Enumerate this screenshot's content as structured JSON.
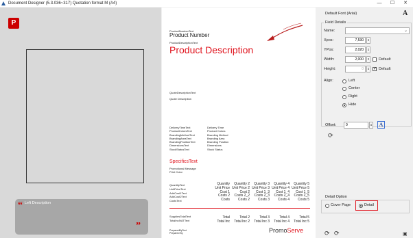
{
  "window": {
    "title": "Document Designer (5.3.036~317) Quotation format M (A4)",
    "minimize": "—",
    "maximize": "☐",
    "close": "✕"
  },
  "left_panel": {
    "logo_letter": "P",
    "description": "Left Description",
    "quote_open": "“",
    "quote_close": "”"
  },
  "page": {
    "product_number_text": "ProductNumberText",
    "product_number": "Product Number",
    "product_description_text": "ProductDescriptionText",
    "product_description": "Product Description",
    "quote_description_text": "QuoteDescriptionText",
    "quote_description": "Quote Description",
    "fields_left": [
      "DeliveryTimeText",
      "ProductColorsText",
      "BrandingMethodText",
      "BrandingAreaText",
      "BrandingPositionText",
      "DimensionsText",
      "StockStatusText"
    ],
    "fields_right": [
      "Delivery Time",
      "Product Colors",
      "Branding Method",
      "Branding Area",
      "Branding Position",
      "Dimensions",
      "Stock Status"
    ],
    "specifics": "SpecificsText",
    "promo_message": "Promotional Message",
    "print_color": "Print Color",
    "price_labels": [
      "QuantityText",
      "UnitPriceText",
      "AddCost1Text",
      "AddCost2Text",
      "CostsText"
    ],
    "price_columns": [
      [
        "Quantity",
        "Unit Price",
        "Cost 1",
        "Costs 2",
        "Costs"
      ],
      [
        "Quantity 2",
        "Unit Price 2",
        "Cost 2",
        "Costs 2_2",
        "Costs 2"
      ],
      [
        "Quantity 3",
        "Unit Price 3",
        "Cost 1_3",
        "Costs 2_3",
        "Costs 3"
      ],
      [
        "Quantity 4",
        "Unit Price 4",
        "Cost 1_4",
        "Costs 2_4",
        "Costs 4"
      ],
      [
        "Quantity 5",
        "Unit Price 5",
        "Cost 1_5",
        "Costs 2_5",
        "Costs 5"
      ]
    ],
    "supplies_total_text": "SuppliesTotalText",
    "total_incl_vat_text": "TotalInclVATText",
    "totals_row1": [
      "Total",
      "Total 2",
      "Total 3",
      "Total 4",
      "Total 5"
    ],
    "totals_row2": [
      "Total Inc",
      "Total Inc 2",
      "Total Inc 3",
      "Total Inc 4",
      "Total Inc 5"
    ],
    "prepared_by_text": "PreparedByText",
    "prepared_by": "Prepared By",
    "brand": {
      "promo": "Promo",
      "serve": "Serve"
    },
    "accent_color": "#e0141e"
  },
  "properties": {
    "default_font": "Default Font (Arial)",
    "font_icon": "A",
    "field_details": "Field Details",
    "name_label": "Name:",
    "name_value": "",
    "xpos_label": "Xpos:",
    "xpos_value": "7,530",
    "ypos_label": "YPos:",
    "ypos_value": "2,020",
    "width_label": "Width:",
    "width_value": "2,000",
    "width_default": "Default",
    "height_label": "Height:",
    "height_value": "0",
    "height_default": "Default",
    "height_default_checked": true,
    "width_default_checked": false,
    "align_label": "Align:",
    "align_options": [
      "Left",
      "Center",
      "Right",
      "Hide"
    ],
    "align_selected": "Hide",
    "offset_label": "Offset:",
    "offset_value": "0",
    "refresh_icon": "refresh-icon",
    "detail_option": "Detail Option",
    "cover_page": "Cover Page",
    "detail": "Detail",
    "detail_selected": "Detail",
    "save_icon": "save-icon"
  }
}
